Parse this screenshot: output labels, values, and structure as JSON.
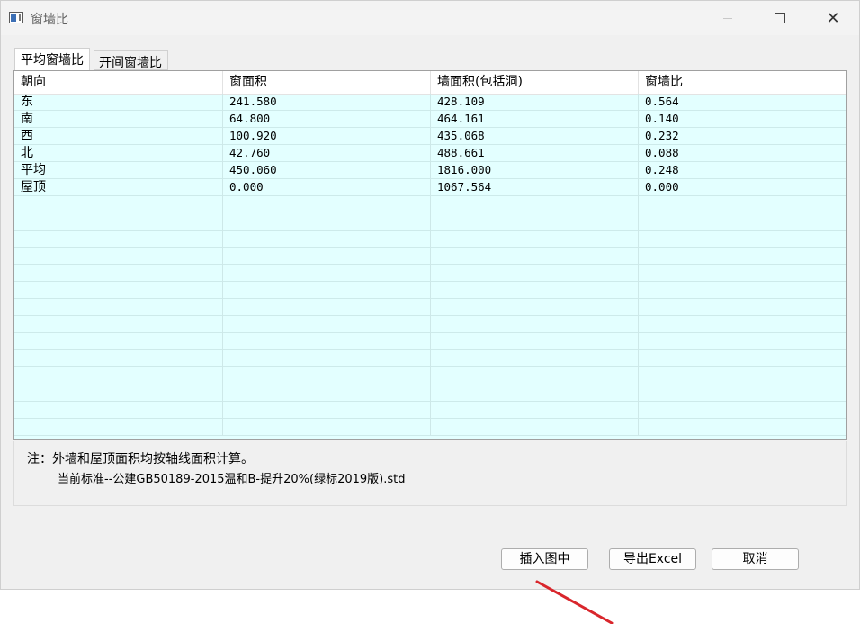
{
  "window": {
    "title": "窗墙比"
  },
  "tabs": [
    {
      "label": "平均窗墙比",
      "active": true
    },
    {
      "label": "开间窗墙比",
      "active": false
    }
  ],
  "table": {
    "headers": [
      "朝向",
      "窗面积",
      "墙面积(包括洞)",
      "窗墙比"
    ],
    "rows": [
      [
        "东",
        "241.580",
        "428.109",
        "0.564"
      ],
      [
        "南",
        "64.800",
        "464.161",
        "0.140"
      ],
      [
        "西",
        "100.920",
        "435.068",
        "0.232"
      ],
      [
        "北",
        "42.760",
        "488.661",
        "0.088"
      ],
      [
        "平均",
        "450.060",
        "1816.000",
        "0.248"
      ],
      [
        "屋顶",
        "0.000",
        "1067.564",
        "0.000"
      ]
    ],
    "empty_rows": 14
  },
  "note": {
    "line1": "注：外墙和屋顶面积均按轴线面积计算。",
    "line2": "当前标准--公建GB50189-2015温和B-提升20%(绿标2019版).std"
  },
  "buttons": {
    "insert": "插入图中",
    "export": "导出Excel",
    "cancel": "取消"
  },
  "colors": {
    "grid_background": "#e3ffff",
    "annotation_arrow": "#d9262c"
  },
  "icons": [
    "app-icon",
    "minimize-icon",
    "maximize-icon",
    "close-icon"
  ]
}
